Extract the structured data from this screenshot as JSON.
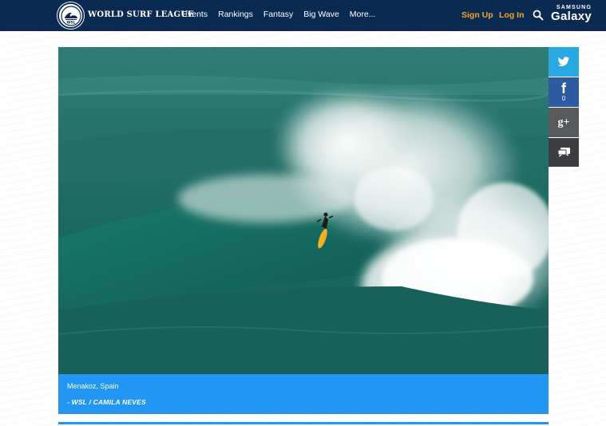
{
  "header": {
    "logo_icon": "wsl-logo-icon",
    "brand": "WORLD SURF LEAGUE",
    "nav": [
      "Events",
      "Rankings",
      "Fantasy",
      "Big Wave",
      "More..."
    ],
    "sign_up": "Sign Up",
    "log_in": "Log In",
    "search_icon": "search-icon",
    "sponsor_line1": "SAMSUNG",
    "sponsor_line2": "Galaxy",
    "colors": {
      "bar": "#0b2a52",
      "accent": "#f5a623"
    }
  },
  "share": {
    "twitter_icon": "twitter-icon",
    "facebook_icon": "facebook-icon",
    "facebook_glyph": "f",
    "facebook_count": "0",
    "google_icon": "google-plus-icon",
    "google_glyph": "g+",
    "comment_icon": "comment-icon"
  },
  "photo": {
    "caption_location": "Menakoz, Spain",
    "caption_credit": "- WSL / CAMILA NEVES",
    "caption_color": "#2196f3"
  }
}
